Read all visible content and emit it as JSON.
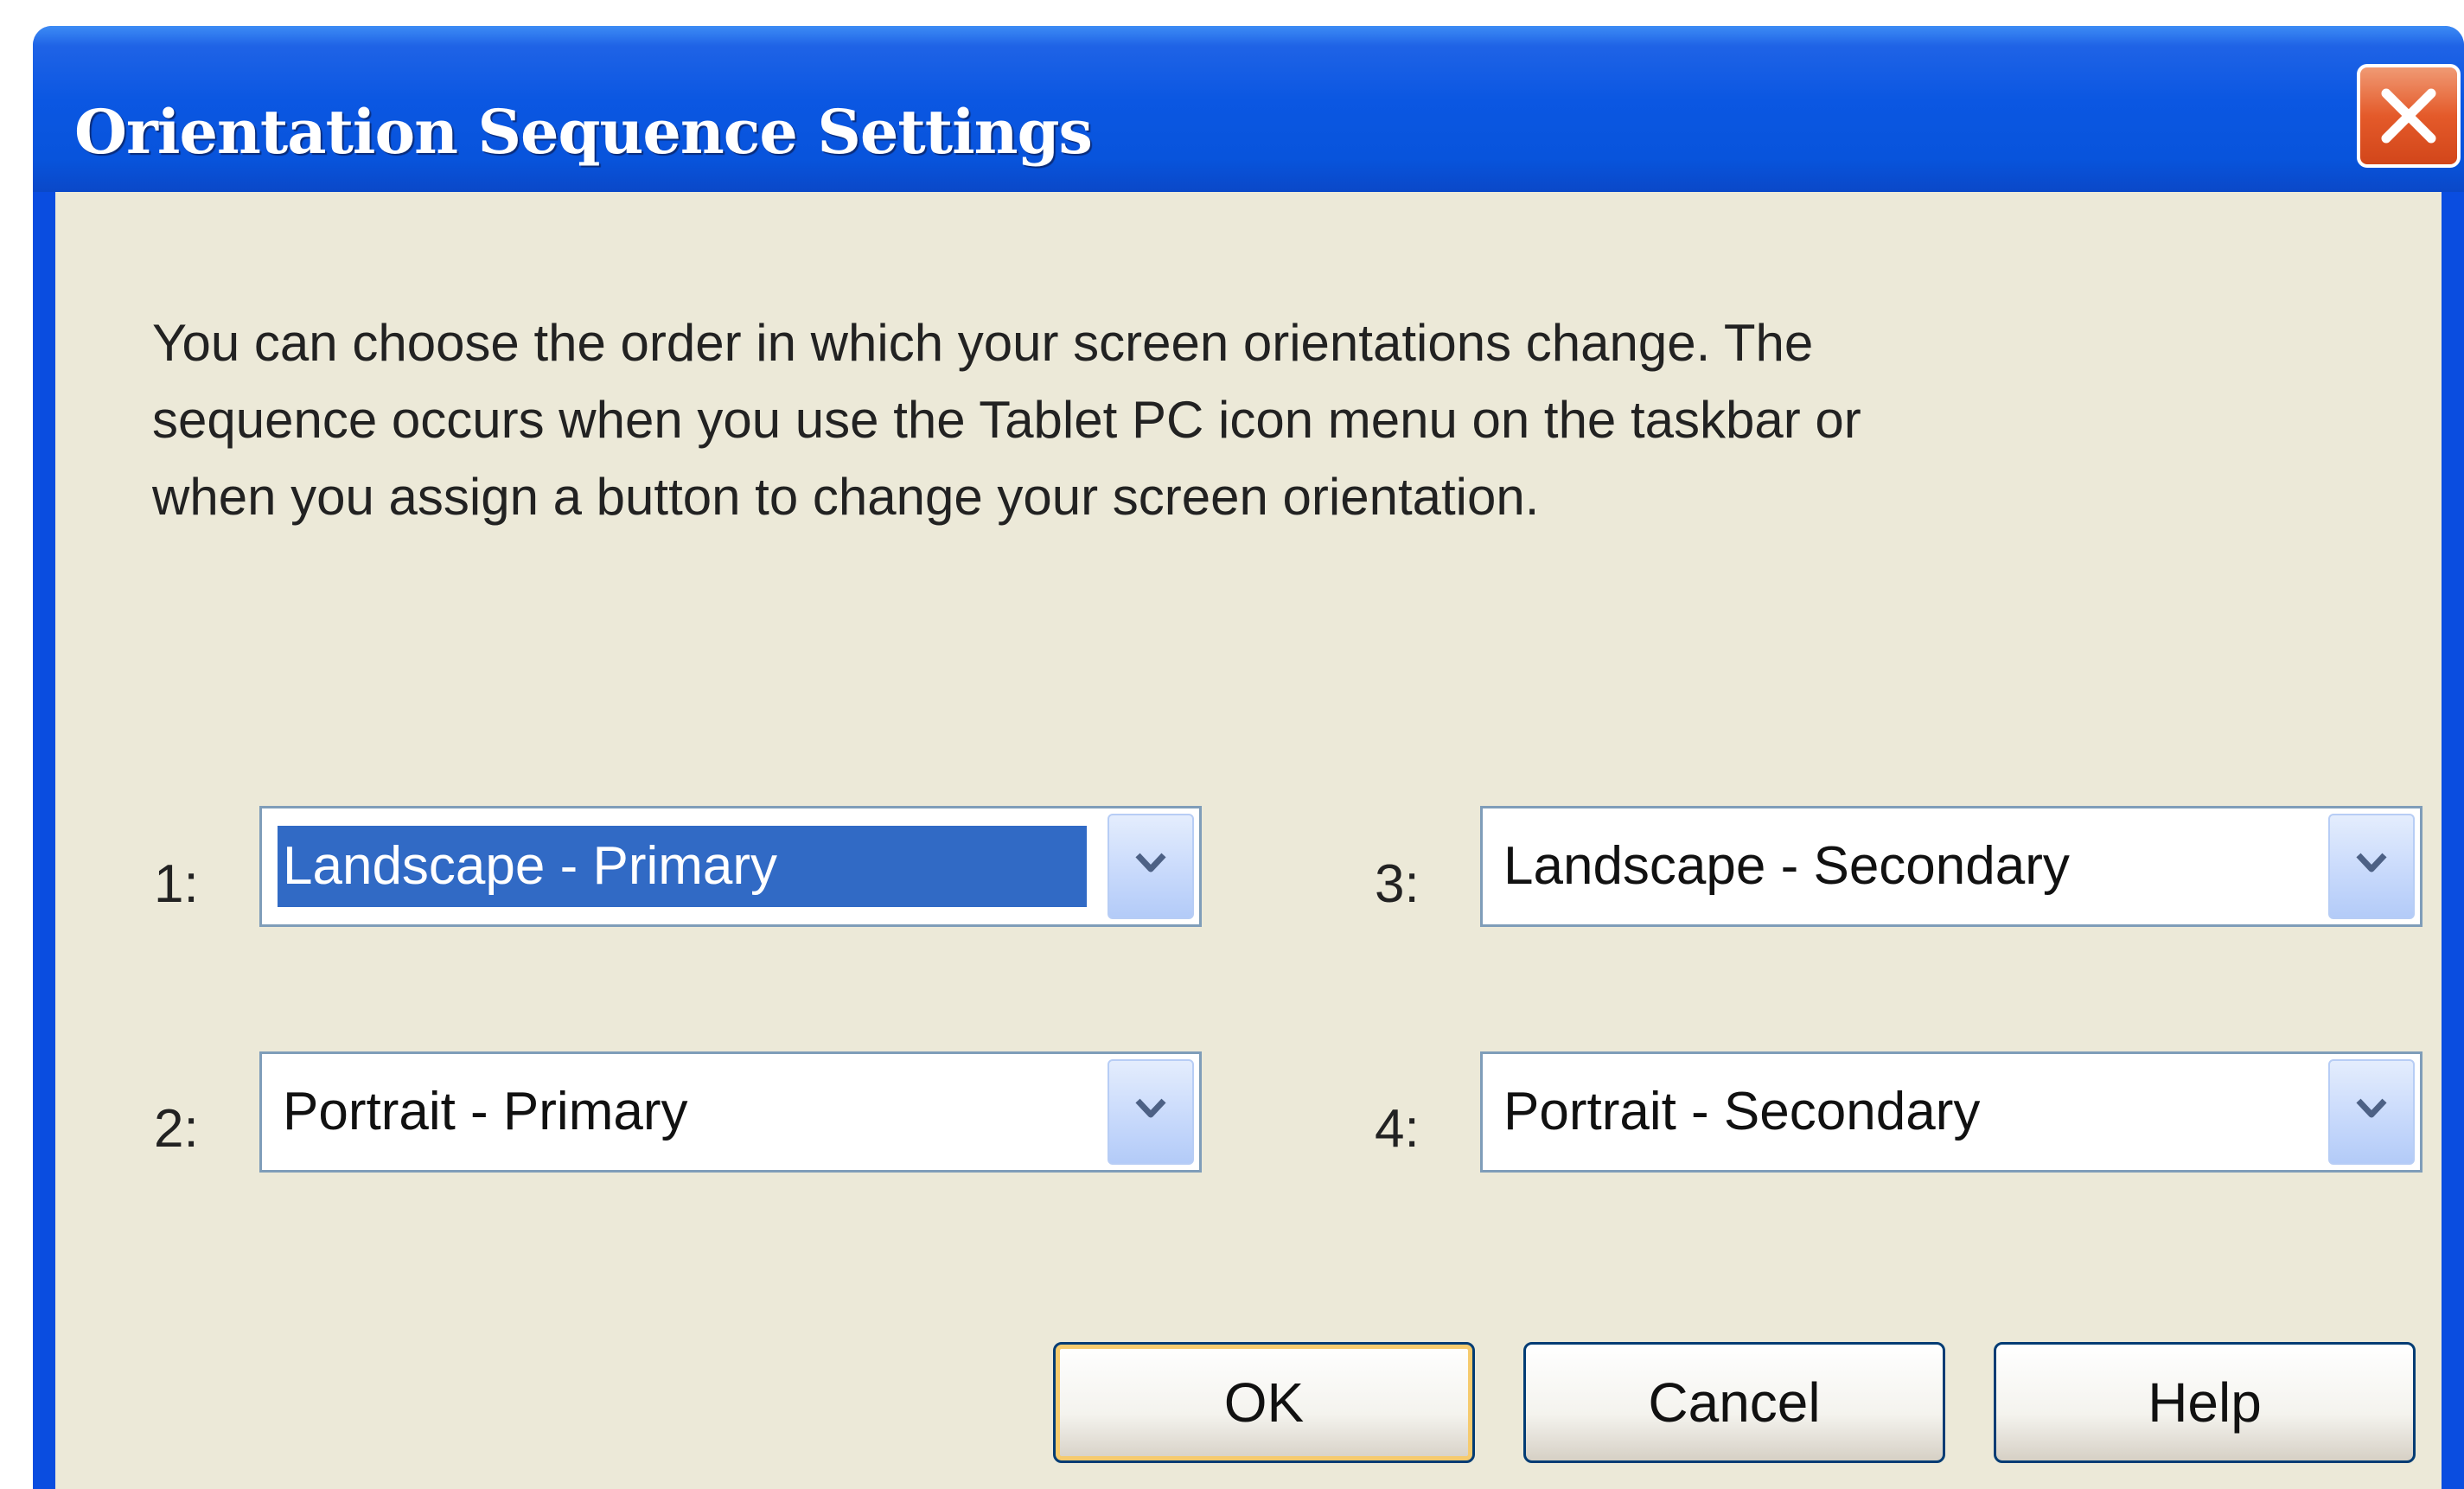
{
  "dialog": {
    "title": "Orientation Sequence Settings",
    "description_lines": [
      "You can choose the order in which your screen orientations change. The",
      "sequence occurs when you use the Tablet PC icon menu on the taskbar or",
      "when you assign a button to change your screen orientation."
    ]
  },
  "sequence": [
    {
      "label": "1:",
      "value": "Landscape - Primary",
      "selected": true
    },
    {
      "label": "2:",
      "value": "Portrait - Primary"
    },
    {
      "label": "3:",
      "value": "Landscape - Secondary"
    },
    {
      "label": "4:",
      "value": "Portrait - Secondary"
    }
  ],
  "buttons": {
    "ok": "OK",
    "cancel": "Cancel",
    "help": "Help"
  },
  "icons": {
    "close": "close-icon",
    "dropdown": "chevron-down-icon"
  },
  "colors": {
    "title_bar": "#0a54dc",
    "close_button": "#e45a2a",
    "dialog_background": "#ece9d8",
    "selection": "#316ac5",
    "default_button_focus": "#f6cb6e"
  }
}
